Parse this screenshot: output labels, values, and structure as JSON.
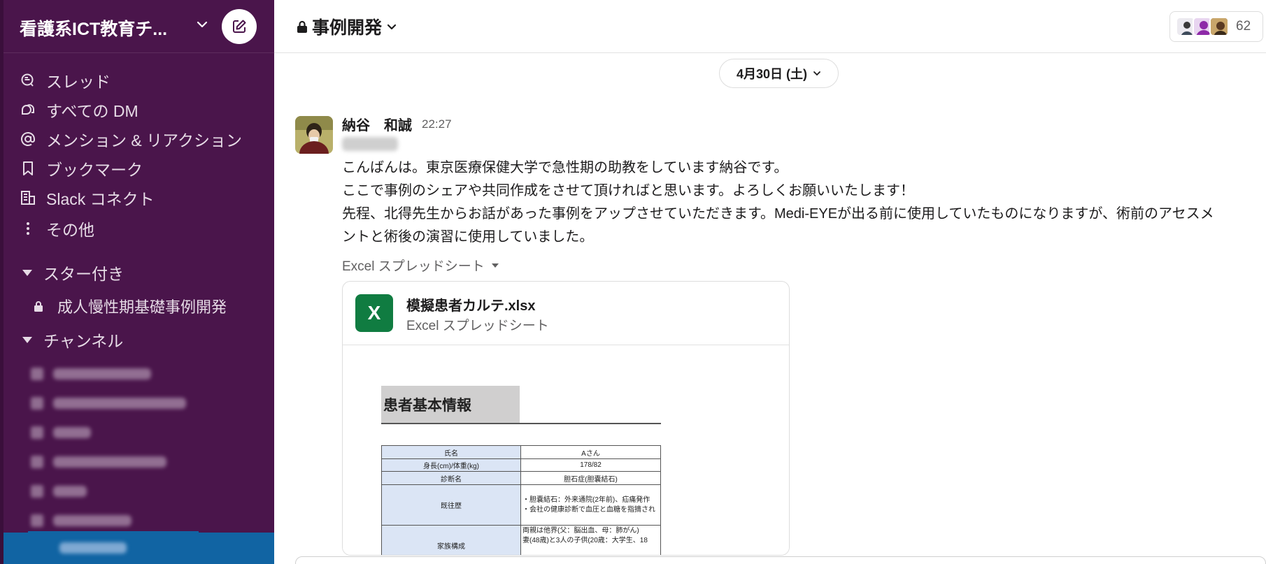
{
  "workspace": {
    "name": "看護系ICT教育チ...",
    "chevron_icon": "chevron-down-icon",
    "compose_icon": "compose-icon"
  },
  "sidebar": {
    "nav": [
      {
        "label": "スレッド",
        "icon": "threads-icon"
      },
      {
        "label": "すべての DM",
        "icon": "dm-icon"
      },
      {
        "label": "メンション & リアクション",
        "icon": "mention-icon"
      },
      {
        "label": "ブックマーク",
        "icon": "bookmark-icon"
      },
      {
        "label": "Slack コネクト",
        "icon": "connect-icon"
      },
      {
        "label": "その他",
        "icon": "more-icon"
      }
    ],
    "starred": {
      "label": "スター付き",
      "items": [
        {
          "label": "成人慢性期基礎事例開発",
          "icon": "lock-icon"
        }
      ]
    },
    "channels": {
      "label": "チャンネル"
    }
  },
  "channel": {
    "name": "事例開発",
    "member_count": "62"
  },
  "date_divider": "4月30日 (土)",
  "message": {
    "author": "納谷　和誠",
    "time": "22:27",
    "lines": [
      "こんばんは。東京医療保健大学で急性期の助教をしています納谷です。",
      "ここで事例のシェアや共同作成をさせて頂ければと思います。よろしくお願いいたします！",
      "先程、北得先生からお話があった事例をアップさせていただきます。Medi-EYEが出る前に使用していたものになりますが、術前のアセスメ",
      "ントと術後の演習に使用していました。"
    ]
  },
  "attachment": {
    "label": "Excel スプレッドシート",
    "icon_letter": "X",
    "file_name": "模擬患者カルテ.xlsx",
    "file_type": "Excel スプレッドシート",
    "preview": {
      "title": "患者基本情報",
      "rows": [
        {
          "label": "氏名",
          "value": "Aさん"
        },
        {
          "label": "身長(cm)/体重(kg)",
          "value": "178/82"
        },
        {
          "label": "診断名",
          "value": "胆石症(胆嚢結石)"
        },
        {
          "label": "既往歴",
          "value": "・胆嚢結石：外来通院(2年前)、疝痛発作"
        },
        {
          "label": "",
          "value": "・会社の健康診断で血圧と血糖を指摘され"
        },
        {
          "label": "家族構成",
          "value": "両親は他界(父：脳出血、母：肺がん)"
        },
        {
          "label": "",
          "value": "妻(48歳)と3人の子供(20歳：大学生、18"
        }
      ]
    }
  },
  "colors": {
    "sidebar_bg": "#4a154b",
    "selected": "#1164a3",
    "excel_green": "#107c41"
  }
}
